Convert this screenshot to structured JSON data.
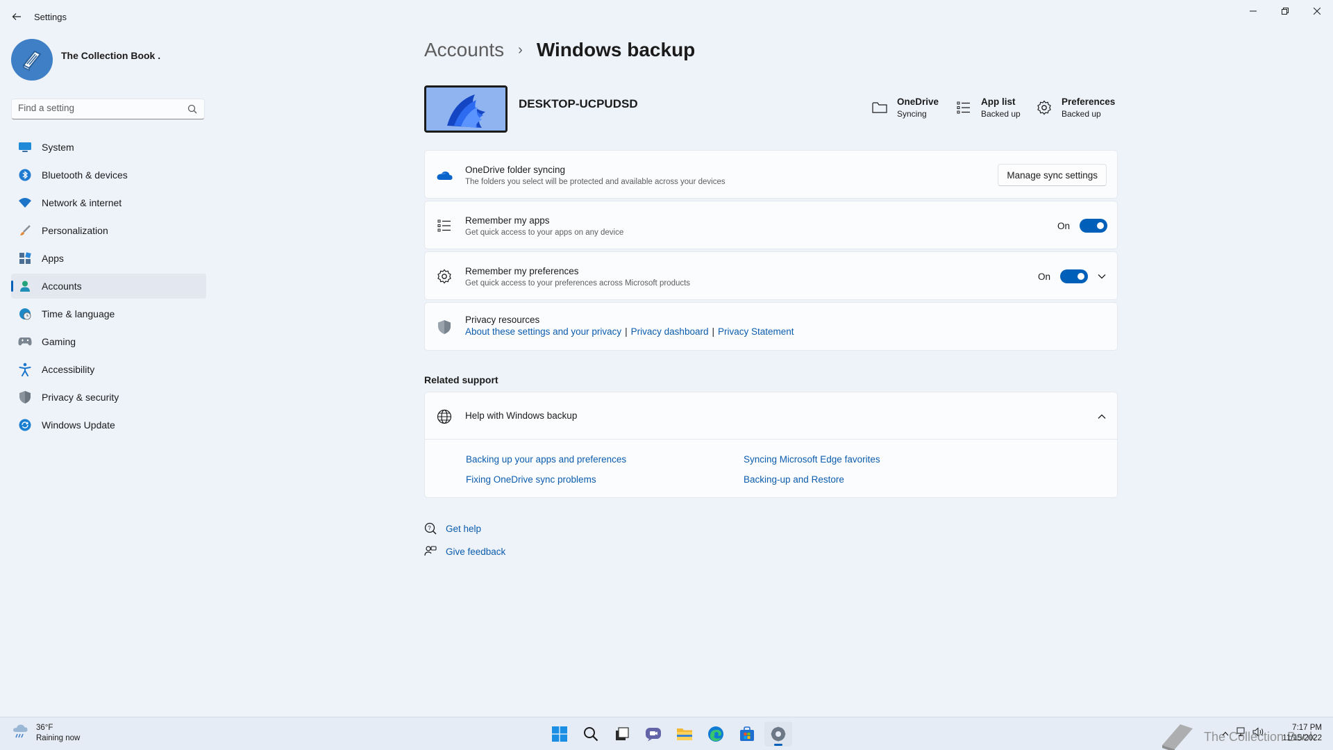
{
  "window": {
    "title": "Settings",
    "minimize_icon": "minimize-icon",
    "restore_icon": "restore-icon",
    "close_icon": "close-icon"
  },
  "profile": {
    "name": "The Collection Book .",
    "avatar_icon": "book-icon"
  },
  "search": {
    "placeholder": "Find a setting",
    "value": ""
  },
  "sidebar": {
    "items": [
      {
        "label": "System",
        "icon": "system-icon",
        "color": "#1e8ad8"
      },
      {
        "label": "Bluetooth & devices",
        "icon": "bluetooth-icon",
        "color": "#1f7ad1"
      },
      {
        "label": "Network & internet",
        "icon": "wifi-icon",
        "color": "#1c74c9"
      },
      {
        "label": "Personalization",
        "icon": "brush-icon",
        "color": "#e38a3a"
      },
      {
        "label": "Apps",
        "icon": "apps-icon",
        "color": "#4a6f93"
      },
      {
        "label": "Accounts",
        "icon": "person-icon",
        "color": "#24a37a"
      },
      {
        "label": "Time & language",
        "icon": "globe-clock-icon",
        "color": "#1f88c7"
      },
      {
        "label": "Gaming",
        "icon": "controller-icon",
        "color": "#7b8591"
      },
      {
        "label": "Accessibility",
        "icon": "accessibility-icon",
        "color": "#1a77cc"
      },
      {
        "label": "Privacy & security",
        "icon": "shield-icon",
        "color": "#6c7680"
      },
      {
        "label": "Windows Update",
        "icon": "update-icon",
        "color": "#1a7fd1"
      }
    ],
    "active_index": 5
  },
  "breadcrumb": {
    "parent": "Accounts",
    "separator": "›",
    "current": "Windows backup"
  },
  "device": {
    "name": "DESKTOP-UCPUDSD"
  },
  "status_items": [
    {
      "title": "OneDrive",
      "subtitle": "Syncing",
      "icon": "folder-icon"
    },
    {
      "title": "App list",
      "subtitle": "Backed up",
      "icon": "list-icon"
    },
    {
      "title": "Preferences",
      "subtitle": "Backed up",
      "icon": "gear-icon"
    }
  ],
  "cards": {
    "onedrive": {
      "title": "OneDrive folder syncing",
      "subtitle": "The folders you select will be protected and available across your devices",
      "button": "Manage sync settings"
    },
    "apps": {
      "title": "Remember my apps",
      "subtitle": "Get quick access to your apps on any device",
      "toggle_label": "On",
      "toggle_on": true
    },
    "preferences": {
      "title": "Remember my preferences",
      "subtitle": "Get quick access to your preferences across Microsoft products",
      "toggle_label": "On",
      "toggle_on": true
    },
    "privacy": {
      "title": "Privacy resources",
      "links": [
        "About these settings and your privacy",
        "Privacy dashboard",
        "Privacy Statement"
      ],
      "separator": "|"
    }
  },
  "related_support": {
    "heading": "Related support",
    "help_title": "Help with Windows backup",
    "links": [
      "Backing up your apps and preferences",
      "Syncing Microsoft Edge favorites",
      "Fixing OneDrive sync problems",
      "Backing-up and Restore"
    ]
  },
  "footer": {
    "get_help": "Get help",
    "give_feedback": "Give feedback"
  },
  "taskbar": {
    "weather_temp": "36°F",
    "weather_desc": "Raining now",
    "apps": [
      "windows-start-icon",
      "search-icon",
      "task-view-icon",
      "chat-icon",
      "file-explorer-icon",
      "edge-icon",
      "store-icon",
      "settings-icon"
    ],
    "watermark": "The Collection Book",
    "time": "7:17 PM",
    "date": "11/15/2022"
  }
}
